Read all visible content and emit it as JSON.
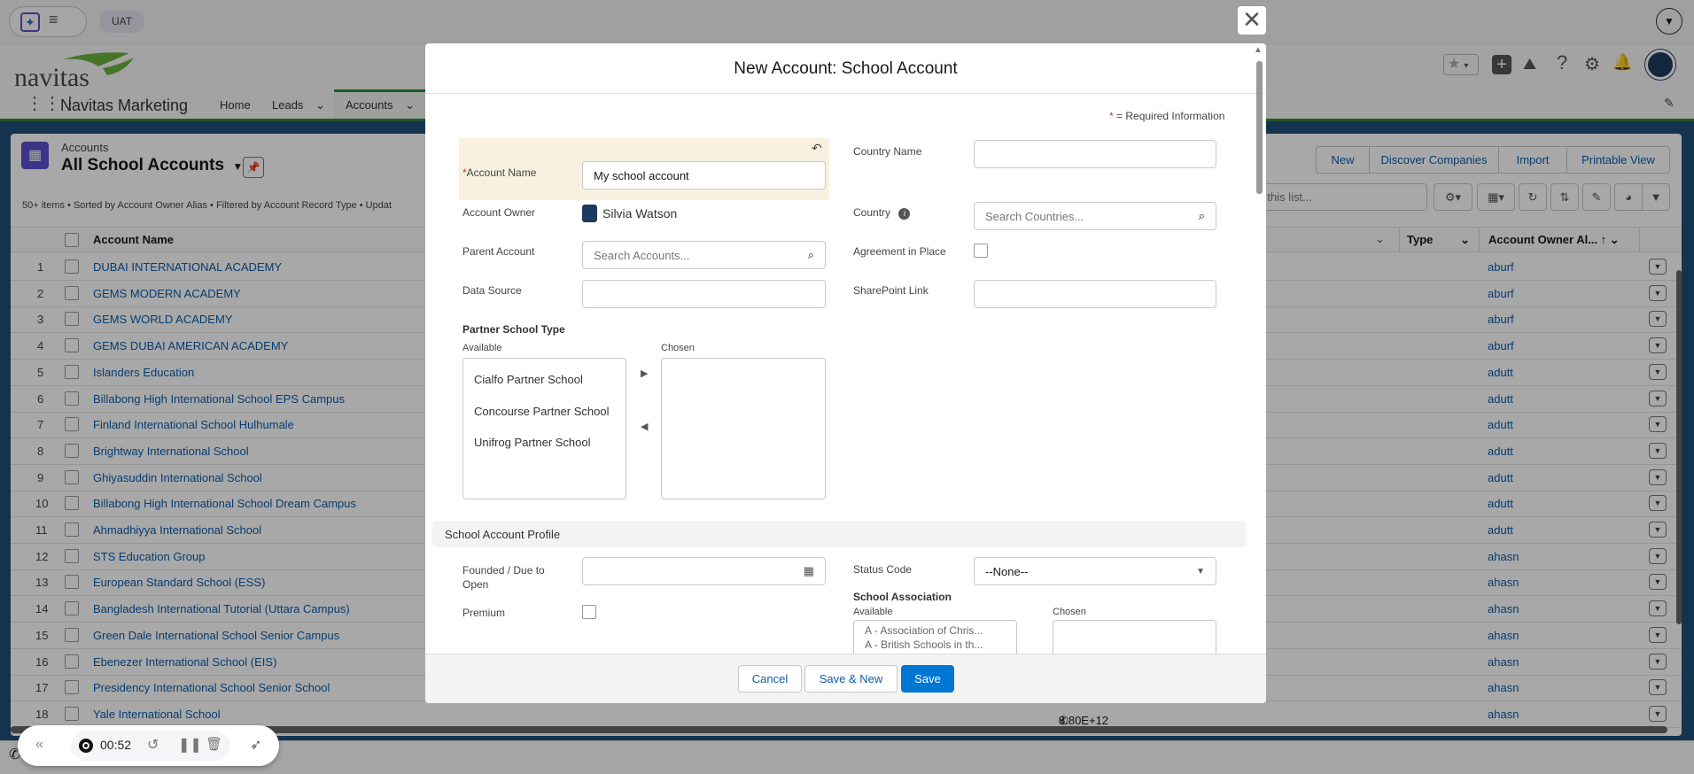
{
  "browser": {
    "env_badge": "UAT"
  },
  "app": {
    "logo_text": "navitas",
    "app_name": "Navitas Marketing",
    "nav": [
      {
        "label": "Home"
      },
      {
        "label": "Leads"
      },
      {
        "label": "Accounts"
      }
    ]
  },
  "list_view": {
    "object_label": "Accounts",
    "title": "All School Accounts",
    "status": "50+ items • Sorted by Account Owner Alias • Filtered by Account Record Type • Updat",
    "buttons": {
      "new": "New",
      "discover": "Discover Companies",
      "import": "Import",
      "printable": "Printable View"
    },
    "search_placeholder": "ch this list...",
    "columns": {
      "name": "Account Name",
      "type": "Type",
      "owner": "Account Owner Al..."
    },
    "rows": [
      {
        "n": "1",
        "name": "DUBAI INTERNATIONAL ACADEMY",
        "owner": "aburf"
      },
      {
        "n": "2",
        "name": "GEMS MODERN ACADEMY",
        "owner": "aburf"
      },
      {
        "n": "3",
        "name": "GEMS WORLD ACADEMY",
        "owner": "aburf"
      },
      {
        "n": "4",
        "name": "GEMS DUBAI AMERICAN ACADEMY",
        "owner": "aburf"
      },
      {
        "n": "5",
        "name": "Islanders Education",
        "owner": "adutt"
      },
      {
        "n": "6",
        "name": "Billabong High International School EPS Campus",
        "owner": "adutt"
      },
      {
        "n": "7",
        "name": "Finland International School Hulhumale",
        "owner": "adutt"
      },
      {
        "n": "8",
        "name": "Brightway International School",
        "owner": "adutt"
      },
      {
        "n": "9",
        "name": "Ghiyasuddin International School",
        "owner": "adutt"
      },
      {
        "n": "10",
        "name": "Billabong High International School Dream Campus",
        "owner": "adutt"
      },
      {
        "n": "11",
        "name": "Ahmadhiyya International School",
        "owner": "adutt"
      },
      {
        "n": "12",
        "name": "STS Education Group",
        "owner": "ahasn"
      },
      {
        "n": "13",
        "name": "European Standard School (ESS)",
        "owner": "ahasn"
      },
      {
        "n": "14",
        "name": "Bangladesh International Tutorial (Uttara Campus)",
        "owner": "ahasn"
      },
      {
        "n": "15",
        "name": "Green Dale International School Senior Campus",
        "owner": "ahasn"
      },
      {
        "n": "16",
        "name": "Ebenezer International School (EIS)",
        "owner": "ahasn"
      },
      {
        "n": "17",
        "name": "Presidency International School Senior School",
        "owner": "ahasn"
      },
      {
        "n": "18",
        "name": "Yale International School",
        "owner": "ahasn",
        "phone": "8.80E+12"
      }
    ]
  },
  "modal": {
    "title": "New Account: School Account",
    "required_note": "= Required Information",
    "required_star": "*",
    "fields": {
      "account_name_label": "Account Name",
      "account_name_value": "My school account",
      "country_name_label": "Country Name",
      "owner_label": "Account Owner",
      "owner_value": "Silvia Watson",
      "country_label": "Country",
      "country_placeholder": "Search Countries...",
      "parent_label": "Parent Account",
      "parent_placeholder": "Search Accounts...",
      "agreement_label": "Agreement in Place",
      "data_source_label": "Data Source",
      "sharepoint_label": "SharePoint Link",
      "partner_type_label": "Partner School Type",
      "available_label": "Available",
      "chosen_label": "Chosen",
      "partner_options": [
        "Cialfo Partner School",
        "Concourse Partner School",
        "Unifrog Partner School"
      ],
      "section_title": "School Account Profile",
      "founded_label_1": "Founded / Due to",
      "founded_label_2": "Open",
      "status_code_label": "Status Code",
      "status_code_value": "--None--",
      "premium_label": "Premium",
      "association_label": "School Association",
      "association_options": [
        "A - Association of Chris...",
        "A - British Schools in th..."
      ]
    },
    "buttons": {
      "cancel": "Cancel",
      "save_new": "Save & New",
      "save": "Save"
    }
  },
  "recorder": {
    "time": "00:52"
  }
}
